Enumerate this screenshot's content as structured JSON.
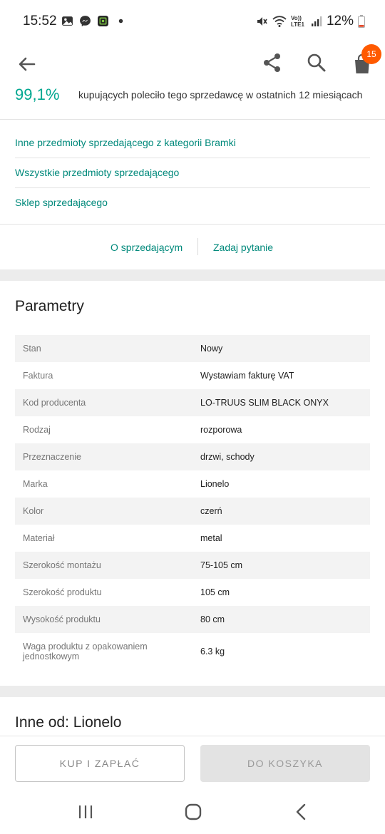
{
  "status_bar": {
    "time": "15:52",
    "battery": "12%",
    "icons": [
      "gallery-icon",
      "messenger-icon",
      "app-icon",
      "dot-icon",
      "mute-icon",
      "wifi-icon",
      "volte-icon",
      "signal-icon",
      "battery-icon"
    ],
    "network_label": "Vo)) LTE1"
  },
  "app_bar": {
    "cart_count": "15",
    "accent": "#ff5a00"
  },
  "seller": {
    "rating_value": "99,1%",
    "rating_text": "kupujących poleciło tego sprzedawcę w ostatnich 12 miesiącach",
    "links": [
      "Inne przedmioty sprzedającego z kategorii Bramki",
      "Wszystkie przedmioty sprzedającego",
      "Sklep sprzedającego"
    ],
    "about_label": "O sprzedającym",
    "ask_label": "Zadaj pytanie",
    "link_color": "#00897b"
  },
  "parameters": {
    "title": "Parametry",
    "rows": [
      {
        "label": "Stan",
        "value": "Nowy"
      },
      {
        "label": "Faktura",
        "value": "Wystawiam fakturę VAT"
      },
      {
        "label": "Kod producenta",
        "value": "LO-TRUUS SLIM BLACK ONYX"
      },
      {
        "label": "Rodzaj",
        "value": "rozporowa"
      },
      {
        "label": "Przeznaczenie",
        "value": "drzwi, schody"
      },
      {
        "label": "Marka",
        "value": "Lionelo"
      },
      {
        "label": "Kolor",
        "value": "czerń"
      },
      {
        "label": "Materiał",
        "value": "metal"
      },
      {
        "label": "Szerokość montażu",
        "value": "75-105 cm"
      },
      {
        "label": "Szerokość produktu",
        "value": "105 cm"
      },
      {
        "label": "Wysokość produktu",
        "value": "80 cm"
      },
      {
        "label": "Waga produktu z opakowaniem jednostkowym",
        "value": "6.3 kg"
      }
    ]
  },
  "more_from": {
    "title": "Inne od: Lionelo"
  },
  "actions": {
    "buy_label": "KUP I ZAPŁAĆ",
    "cart_label": "DO KOSZYKA"
  }
}
